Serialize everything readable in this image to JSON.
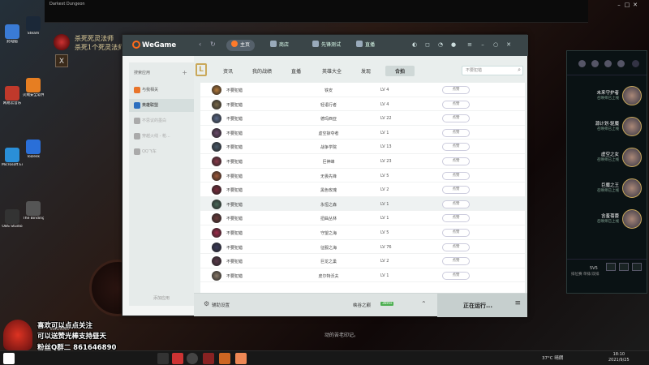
{
  "desktop": {
    "icons": [
      "此电脑",
      "网易云音乐",
      "Microsoft Edge",
      "OBS Studio",
      "Steam",
      "火绒安全软件",
      "ToDesk",
      "The Binding of Isaac"
    ],
    "game_title": "Darkest Dungeon",
    "game_name_line1": "杀死死灵法师",
    "game_name_line2": "杀死1个死灵法师",
    "game_badge": "X",
    "game_footer": "动的苦老印记。"
  },
  "wegame": {
    "logo": "WeGame",
    "nav": [
      {
        "label": "主页",
        "active": true
      },
      {
        "label": "商店",
        "active": false
      },
      {
        "label": "先锋测试",
        "active": false
      },
      {
        "label": "直播",
        "active": false
      }
    ],
    "sidebar": {
      "header": "搜索应用",
      "items": [
        {
          "label": "与我相关",
          "active": false,
          "dim": false
        },
        {
          "label": "英雄联盟",
          "active": true,
          "dim": false
        },
        {
          "label": "不思议的墨白",
          "active": false,
          "dim": true
        },
        {
          "label": "穿越火线 - 枪...",
          "active": false,
          "dim": true
        },
        {
          "label": "QQ飞车",
          "active": false,
          "dim": true
        }
      ],
      "footer": "添加应用"
    },
    "subtabs": [
      {
        "label": "资讯",
        "active": false
      },
      {
        "label": "我的战绩",
        "active": false
      },
      {
        "label": "直播",
        "active": false
      },
      {
        "label": "英雄大全",
        "active": false
      },
      {
        "label": "发现",
        "active": false
      },
      {
        "label": "合拍",
        "active": true
      }
    ],
    "search_placeholder": "不要犯错",
    "rows": [
      {
        "name": "不要犯错",
        "champion": "铁安",
        "level": "LV 4",
        "action": "点赞",
        "color": "#b57a3a"
      },
      {
        "name": "不要犯错",
        "champion": "轻语行者",
        "level": "LV 4",
        "action": "点赞",
        "color": "#7a6a4a"
      },
      {
        "name": "不要犯错",
        "champion": "德玛西亚",
        "level": "LV 22",
        "action": "点赞",
        "color": "#5a6a8a"
      },
      {
        "name": "不要犯错",
        "champion": "虚空掠夺者",
        "level": "LV 1",
        "action": "点赞",
        "color": "#6a4a6a"
      },
      {
        "name": "不要犯错",
        "champion": "战争学院",
        "level": "LV 13",
        "action": "点赞",
        "color": "#4a5a6a"
      },
      {
        "name": "不要犯错",
        "champion": "巨神峰",
        "level": "LV 23",
        "action": "点赞",
        "color": "#8a3a4a"
      },
      {
        "name": "不要犯错",
        "champion": "无畏先锋",
        "level": "LV 5",
        "action": "点赞",
        "color": "#a05a3a"
      },
      {
        "name": "不要犯错",
        "champion": "黑色玫瑰",
        "level": "LV 2",
        "action": "点赞",
        "color": "#7a2a3a"
      },
      {
        "name": "不要犯错",
        "champion": "永恒之森",
        "level": "LV 1",
        "action": "点赞",
        "color": "#4a6a5a"
      },
      {
        "name": "不要犯错",
        "champion": "扭曲丛林",
        "level": "LV 1",
        "action": "点赞",
        "color": "#6a3a3a"
      },
      {
        "name": "不要犯错",
        "champion": "守望之海",
        "level": "LV 5",
        "action": "点赞",
        "color": "#a02a4a"
      },
      {
        "name": "不要犯错",
        "champion": "征服之海",
        "level": "LV 76",
        "action": "点赞",
        "color": "#3a3a5a"
      },
      {
        "name": "不要犯错",
        "champion": "巨龙之巢",
        "level": "LV 2",
        "action": "点赞",
        "color": "#5a3a4a"
      },
      {
        "name": "不要犯错",
        "champion": "皮尔特沃夫",
        "level": "LV 1",
        "action": "点赞",
        "color": "#8a7a6a"
      }
    ],
    "highlight_row": 8,
    "bottom": {
      "assist": "辅助设置",
      "region": "峡谷之巅",
      "ping": "38ms",
      "running": "正在运行..."
    }
  },
  "lol_client": {
    "friends": [
      {
        "name": "未来守护者",
        "status": "召唤师已上线"
      },
      {
        "name": "源计划·驱魔",
        "status": "召唤师已上线"
      },
      {
        "name": "虚空之女",
        "status": "召唤师已上线"
      },
      {
        "name": "巨魔之王",
        "status": "召唤师已上线"
      },
      {
        "name": "含羞蓓蕾",
        "status": "召唤师已上线"
      }
    ],
    "version": "5V5",
    "status_line": "排位赛 单排/双排"
  },
  "overlay": {
    "line1": "喜欢可以点点关注",
    "line2": "可以送赞光棒支持昼天",
    "line3": "粉丝Q群二 861646890",
    "date": "2021/09/25"
  },
  "taskbar": {
    "weather": "37°C 晴朗",
    "time": "18:10",
    "date": "2021/9/25"
  }
}
